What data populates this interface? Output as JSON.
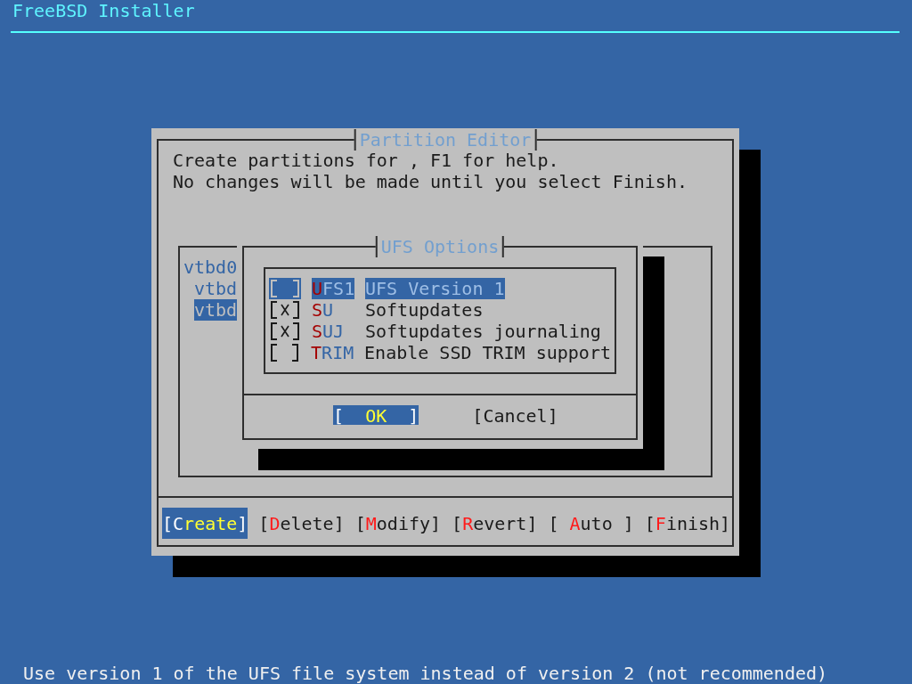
{
  "header": {
    "title": "FreeBSD Installer"
  },
  "partition_editor": {
    "title": "Partition Editor",
    "message_lines": [
      "Create partitions for , F1 for help.",
      "No changes will be made until you select Finish."
    ],
    "partitions": [
      {
        "label": "vtbd0",
        "selected": false,
        "children": [
          {
            "label": "vtbd",
            "selected": false
          },
          {
            "label": "vtbd",
            "selected": true
          }
        ]
      }
    ],
    "buttons": [
      {
        "open": "[",
        "hotkey": "C",
        "rest": "reate",
        "close": "]",
        "selected": true
      },
      {
        "open": "[",
        "hotkey": "D",
        "rest": "elete",
        "close": "]",
        "selected": false
      },
      {
        "open": "[",
        "hotkey": "M",
        "rest": "odify",
        "close": "]",
        "selected": false
      },
      {
        "open": "[",
        "hotkey": "R",
        "rest": "evert",
        "close": "]",
        "selected": false
      },
      {
        "open": "[ ",
        "hotkey": "A",
        "rest": "uto ",
        "close": "]",
        "selected": false
      },
      {
        "open": "[",
        "hotkey": "F",
        "rest": "inish",
        "close": "]",
        "selected": false
      }
    ]
  },
  "ufs_options": {
    "title": "UFS Options",
    "options": [
      {
        "checked": false,
        "hotkey": "U",
        "name_rest": "FS1",
        "description": "UFS Version 1",
        "selected": true
      },
      {
        "checked": true,
        "hotkey": "S",
        "name_rest": "U",
        "description": "Softupdates",
        "selected": false
      },
      {
        "checked": true,
        "hotkey": "S",
        "name_rest": "UJ",
        "description": "Softupdates journaling",
        "selected": false
      },
      {
        "checked": false,
        "hotkey": "T",
        "name_rest": "RIM",
        "description": "Enable SSD TRIM support",
        "selected": false
      }
    ],
    "buttons": [
      {
        "open": "[",
        "label": "  OK  ",
        "close": "]",
        "selected": true
      },
      {
        "open": "[",
        "label": "Cancel",
        "close": "]",
        "selected": false
      }
    ]
  },
  "status_bar": {
    "text": "Use version 1 of the UFS file system instead of version 2 (not recommended)"
  }
}
